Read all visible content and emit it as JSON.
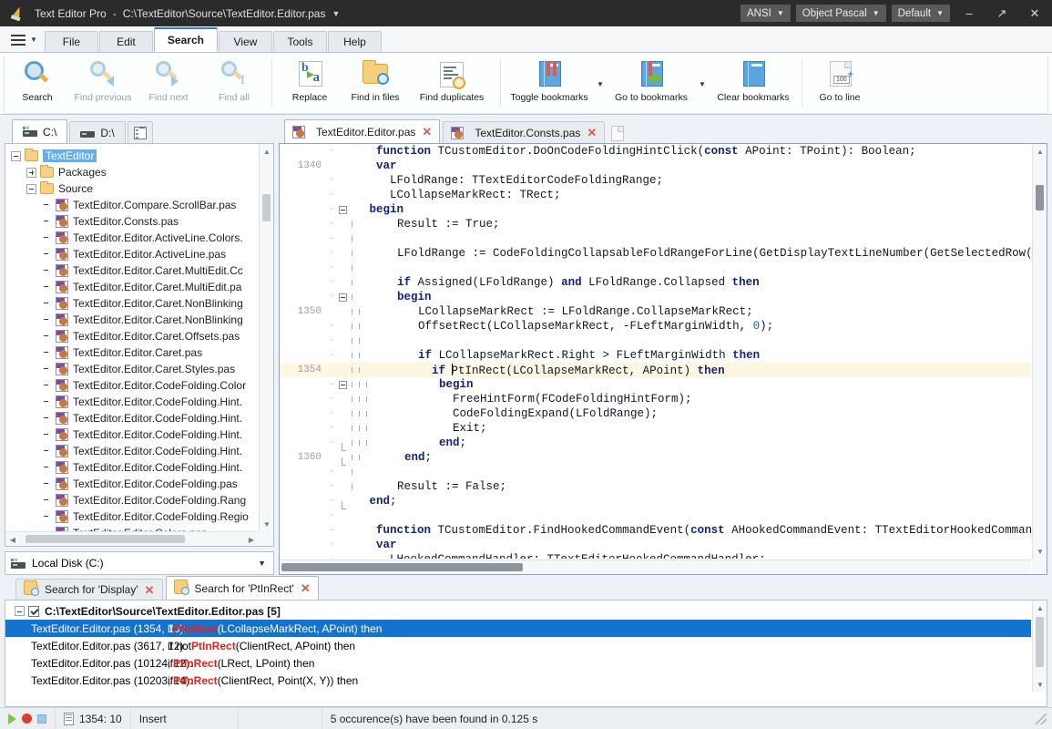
{
  "titlebar": {
    "app_name": "Text Editor Pro",
    "separator": "-",
    "file_path": "C:\\TextEditor\\Source\\TextEditor.Editor.pas",
    "dropdown_caret": "▼",
    "encoding": "ANSI",
    "language": "Object Pascal",
    "theme": "Default",
    "minimize": "–",
    "restore": "↗",
    "close": "✕"
  },
  "menubar": {
    "hamburger_caret": "▼",
    "tabs": [
      {
        "label": "File",
        "active": false
      },
      {
        "label": "Edit",
        "active": false
      },
      {
        "label": "Search",
        "active": true
      },
      {
        "label": "View",
        "active": false
      },
      {
        "label": "Tools",
        "active": false
      },
      {
        "label": "Help",
        "active": false
      }
    ]
  },
  "ribbon": {
    "buttons": [
      {
        "label": "Search",
        "icon": "search-magnifier-icon",
        "disabled": false
      },
      {
        "label": "Find previous",
        "icon": "find-previous-icon",
        "disabled": true
      },
      {
        "label": "Find next",
        "icon": "find-next-icon",
        "disabled": true
      },
      {
        "label": "Find all",
        "icon": "find-all-icon",
        "disabled": true
      },
      {
        "label": "Replace",
        "icon": "replace-icon",
        "disabled": false
      },
      {
        "label": "Find in files",
        "icon": "find-in-files-icon",
        "disabled": false
      },
      {
        "label": "Find duplicates",
        "icon": "find-duplicates-icon",
        "disabled": false
      },
      {
        "label": "Toggle bookmarks",
        "icon": "toggle-bookmarks-icon",
        "disabled": false
      },
      {
        "label": "Go to bookmarks",
        "icon": "go-to-bookmarks-icon",
        "disabled": false
      },
      {
        "label": "Clear bookmarks",
        "icon": "clear-bookmarks-icon",
        "disabled": false
      },
      {
        "label": "Go to line",
        "icon": "go-to-line-icon",
        "disabled": false
      }
    ],
    "split_caret": "▼"
  },
  "left_panel": {
    "drive_tabs": [
      {
        "label": "C:\\",
        "active": true
      },
      {
        "label": "D:\\",
        "active": false
      }
    ],
    "list_view_tab": "list-view-icon",
    "tree": [
      {
        "label": "TextEditor",
        "indent": 0,
        "type": "folder",
        "expander": "minus",
        "selected": true
      },
      {
        "label": "Packages",
        "indent": 1,
        "type": "folder",
        "expander": "plus",
        "selected": false
      },
      {
        "label": "Source",
        "indent": 1,
        "type": "folder",
        "expander": "minus",
        "selected": false
      },
      {
        "label": "TextEditor.Compare.ScrollBar.pas",
        "indent": 2,
        "type": "pas",
        "expander": "none",
        "selected": false
      },
      {
        "label": "TextEditor.Consts.pas",
        "indent": 2,
        "type": "pas",
        "expander": "none",
        "selected": false
      },
      {
        "label": "TextEditor.Editor.ActiveLine.Colors.",
        "indent": 2,
        "type": "pas",
        "expander": "none",
        "selected": false
      },
      {
        "label": "TextEditor.Editor.ActiveLine.pas",
        "indent": 2,
        "type": "pas",
        "expander": "none",
        "selected": false
      },
      {
        "label": "TextEditor.Editor.Caret.MultiEdit.Cc",
        "indent": 2,
        "type": "pas",
        "expander": "none",
        "selected": false
      },
      {
        "label": "TextEditor.Editor.Caret.MultiEdit.pa",
        "indent": 2,
        "type": "pas",
        "expander": "none",
        "selected": false
      },
      {
        "label": "TextEditor.Editor.Caret.NonBlinking",
        "indent": 2,
        "type": "pas",
        "expander": "none",
        "selected": false
      },
      {
        "label": "TextEditor.Editor.Caret.NonBlinking",
        "indent": 2,
        "type": "pas",
        "expander": "none",
        "selected": false
      },
      {
        "label": "TextEditor.Editor.Caret.Offsets.pas",
        "indent": 2,
        "type": "pas",
        "expander": "none",
        "selected": false
      },
      {
        "label": "TextEditor.Editor.Caret.pas",
        "indent": 2,
        "type": "pas",
        "expander": "none",
        "selected": false
      },
      {
        "label": "TextEditor.Editor.Caret.Styles.pas",
        "indent": 2,
        "type": "pas",
        "expander": "none",
        "selected": false
      },
      {
        "label": "TextEditor.Editor.CodeFolding.Color",
        "indent": 2,
        "type": "pas",
        "expander": "none",
        "selected": false
      },
      {
        "label": "TextEditor.Editor.CodeFolding.Hint.",
        "indent": 2,
        "type": "pas",
        "expander": "none",
        "selected": false
      },
      {
        "label": "TextEditor.Editor.CodeFolding.Hint.",
        "indent": 2,
        "type": "pas",
        "expander": "none",
        "selected": false
      },
      {
        "label": "TextEditor.Editor.CodeFolding.Hint.",
        "indent": 2,
        "type": "pas",
        "expander": "none",
        "selected": false
      },
      {
        "label": "TextEditor.Editor.CodeFolding.Hint.",
        "indent": 2,
        "type": "pas",
        "expander": "none",
        "selected": false
      },
      {
        "label": "TextEditor.Editor.CodeFolding.Hint.",
        "indent": 2,
        "type": "pas",
        "expander": "none",
        "selected": false
      },
      {
        "label": "TextEditor.Editor.CodeFolding.pas",
        "indent": 2,
        "type": "pas",
        "expander": "none",
        "selected": false
      },
      {
        "label": "TextEditor.Editor.CodeFolding.Rang",
        "indent": 2,
        "type": "pas",
        "expander": "none",
        "selected": false
      },
      {
        "label": "TextEditor.Editor.CodeFolding.Regio",
        "indent": 2,
        "type": "pas",
        "expander": "none",
        "selected": false
      },
      {
        "label": "TextEditor.Editor.Colors.pas",
        "indent": 2,
        "type": "pas",
        "expander": "none",
        "selected": false
      }
    ],
    "drive_combo": {
      "label": "Local Disk (C:)",
      "caret": "▼"
    }
  },
  "editor": {
    "tabs": [
      {
        "label": "TextEditor.Editor.pas",
        "active": true,
        "close": "✕"
      },
      {
        "label": "TextEditor.Consts.pas",
        "active": false,
        "close": "✕"
      }
    ],
    "lines": [
      {
        "num": "",
        "dot": "·",
        "fold": "none",
        "depth": 0,
        "highlight": false,
        "tokens": [
          {
            "t": "    ",
            "k": "p"
          },
          {
            "t": "function",
            "k": "kw"
          },
          {
            "t": " TCustomEditor.DoOnCodeFoldingHintClick(",
            "k": "p"
          },
          {
            "t": "const",
            "k": "kw"
          },
          {
            "t": " APoint: TPoint): Boolean;",
            "k": "p"
          }
        ]
      },
      {
        "num": "1340",
        "dot": "",
        "fold": "none",
        "depth": 0,
        "highlight": false,
        "tokens": [
          {
            "t": "    ",
            "k": "p"
          },
          {
            "t": "var",
            "k": "kw"
          }
        ]
      },
      {
        "num": "",
        "dot": "·",
        "fold": "none",
        "depth": 0,
        "highlight": false,
        "tokens": [
          {
            "t": "      LFoldRange: TTextEditorCodeFoldingRange;",
            "k": "p"
          }
        ]
      },
      {
        "num": "",
        "dot": "·",
        "fold": "none",
        "depth": 0,
        "highlight": false,
        "tokens": [
          {
            "t": "      LCollapseMarkRect: TRect;",
            "k": "p"
          }
        ]
      },
      {
        "num": "",
        "dot": "·",
        "fold": "box",
        "depth": 0,
        "highlight": false,
        "tokens": [
          {
            "t": "   ",
            "k": "p"
          },
          {
            "t": "begin",
            "k": "kw"
          }
        ]
      },
      {
        "num": "",
        "dot": "·",
        "fold": "line",
        "depth": 1,
        "highlight": false,
        "tokens": [
          {
            "t": "      Result := True;",
            "k": "p"
          }
        ]
      },
      {
        "num": "",
        "dot": "–",
        "fold": "line",
        "depth": 1,
        "highlight": false,
        "tokens": [
          {
            "t": "",
            "k": "p"
          }
        ]
      },
      {
        "num": "",
        "dot": "·",
        "fold": "line",
        "depth": 1,
        "highlight": false,
        "tokens": [
          {
            "t": "      LFoldRange := CodeFoldingCollapsableFoldRangeForLine(GetDisplayTextLineNumber(GetSelectedRow(APoint.Y)",
            "k": "p"
          }
        ]
      },
      {
        "num": "",
        "dot": "·",
        "fold": "line",
        "depth": 1,
        "highlight": false,
        "tokens": [
          {
            "t": "",
            "k": "p"
          }
        ]
      },
      {
        "num": "",
        "dot": "·",
        "fold": "line",
        "depth": 1,
        "highlight": false,
        "tokens": [
          {
            "t": "      ",
            "k": "p"
          },
          {
            "t": "if",
            "k": "kw"
          },
          {
            "t": " Assigned(LFoldRange) ",
            "k": "p"
          },
          {
            "t": "and",
            "k": "kw"
          },
          {
            "t": " LFoldRange.Collapsed ",
            "k": "p"
          },
          {
            "t": "then",
            "k": "kw"
          }
        ]
      },
      {
        "num": "",
        "dot": "·",
        "fold": "box",
        "depth": 1,
        "highlight": false,
        "tokens": [
          {
            "t": "      ",
            "k": "p"
          },
          {
            "t": "begin",
            "k": "kw"
          }
        ]
      },
      {
        "num": "1350",
        "dot": "",
        "fold": "line2",
        "depth": 2,
        "highlight": false,
        "tokens": [
          {
            "t": "        LCollapseMarkRect := LFoldRange.CollapseMarkRect;",
            "k": "p"
          }
        ]
      },
      {
        "num": "",
        "dot": "·",
        "fold": "line2",
        "depth": 2,
        "highlight": false,
        "tokens": [
          {
            "t": "        OffsetRect(LCollapseMarkRect, -FLeftMarginWidth, ",
            "k": "p"
          },
          {
            "t": "0",
            "k": "num"
          },
          {
            "t": ");",
            "k": "p"
          }
        ]
      },
      {
        "num": "",
        "dot": "·",
        "fold": "line2",
        "depth": 2,
        "highlight": false,
        "tokens": [
          {
            "t": "",
            "k": "p"
          }
        ]
      },
      {
        "num": "",
        "dot": "·",
        "fold": "line2",
        "depth": 2,
        "highlight": false,
        "tokens": [
          {
            "t": "        ",
            "k": "p"
          },
          {
            "t": "if",
            "k": "kw"
          },
          {
            "t": " LCollapseMarkRect.Right > FLeftMarginWidth ",
            "k": "p"
          },
          {
            "t": "then",
            "k": "kw"
          }
        ]
      },
      {
        "num": "1354",
        "dot": "",
        "fold": "line2",
        "depth": 2,
        "highlight": true,
        "tokens": [
          {
            "t": "          ",
            "k": "p"
          },
          {
            "t": "if",
            "k": "kw"
          },
          {
            "t": " ",
            "k": "p"
          },
          {
            "t": "|",
            "k": "caret"
          },
          {
            "t": "PtInRect(LCollapseMarkRect, APoint) ",
            "k": "p"
          },
          {
            "t": "then",
            "k": "kw"
          }
        ]
      },
      {
        "num": "",
        "dot": "–",
        "fold": "box2",
        "depth": 3,
        "highlight": false,
        "tokens": [
          {
            "t": "          ",
            "k": "p"
          },
          {
            "t": "begin",
            "k": "kw"
          }
        ]
      },
      {
        "num": "",
        "dot": "·",
        "fold": "line3",
        "depth": 3,
        "highlight": false,
        "tokens": [
          {
            "t": "            FreeHintForm(FCodeFoldingHintForm);",
            "k": "p"
          }
        ]
      },
      {
        "num": "",
        "dot": "·",
        "fold": "line3",
        "depth": 3,
        "highlight": false,
        "tokens": [
          {
            "t": "            CodeFoldingExpand(LFoldRange);",
            "k": "p"
          }
        ]
      },
      {
        "num": "",
        "dot": "·",
        "fold": "line3",
        "depth": 3,
        "highlight": false,
        "tokens": [
          {
            "t": "            Exit;",
            "k": "p"
          }
        ]
      },
      {
        "num": "",
        "dot": "·",
        "fold": "end3",
        "depth": 3,
        "highlight": false,
        "tokens": [
          {
            "t": "          ",
            "k": "p"
          },
          {
            "t": "end",
            "k": "kw"
          },
          {
            "t": ";",
            "k": "p"
          }
        ]
      },
      {
        "num": "1360",
        "dot": "",
        "fold": "end2",
        "depth": 2,
        "highlight": false,
        "tokens": [
          {
            "t": "      ",
            "k": "p"
          },
          {
            "t": "end",
            "k": "kw"
          },
          {
            "t": ";",
            "k": "p"
          }
        ]
      },
      {
        "num": "",
        "dot": "·",
        "fold": "line",
        "depth": 1,
        "highlight": false,
        "tokens": [
          {
            "t": "",
            "k": "p"
          }
        ]
      },
      {
        "num": "",
        "dot": "·",
        "fold": "line",
        "depth": 1,
        "highlight": false,
        "tokens": [
          {
            "t": "      Result := False;",
            "k": "p"
          }
        ]
      },
      {
        "num": "",
        "dot": "·",
        "fold": "end1",
        "depth": 0,
        "highlight": false,
        "tokens": [
          {
            "t": "   ",
            "k": "p"
          },
          {
            "t": "end",
            "k": "kw"
          },
          {
            "t": ";",
            "k": "p"
          }
        ]
      },
      {
        "num": "",
        "dot": "·",
        "fold": "none",
        "depth": 0,
        "highlight": false,
        "tokens": [
          {
            "t": "",
            "k": "p"
          }
        ]
      },
      {
        "num": "",
        "dot": "–",
        "fold": "none",
        "depth": 0,
        "highlight": false,
        "tokens": [
          {
            "t": "    ",
            "k": "p"
          },
          {
            "t": "function",
            "k": "kw"
          },
          {
            "t": " TCustomEditor.FindHookedCommandEvent(",
            "k": "p"
          },
          {
            "t": "const",
            "k": "kw"
          },
          {
            "t": " AHookedCommandEvent: TTextEditorHookedCommandEvent):",
            "k": "p"
          }
        ]
      },
      {
        "num": "",
        "dot": "·",
        "fold": "none",
        "depth": 0,
        "highlight": false,
        "tokens": [
          {
            "t": "    ",
            "k": "p"
          },
          {
            "t": "var",
            "k": "kw"
          }
        ]
      },
      {
        "num": "",
        "dot": "·",
        "fold": "none",
        "depth": 0,
        "highlight": false,
        "tokens": [
          {
            "t": "      LHookedCommandHandler: TTextEditorHookedCommandHandler;",
            "k": "p"
          }
        ]
      }
    ]
  },
  "results": {
    "tabs": [
      {
        "label": "Search for 'Display'",
        "active": false,
        "close": "✕"
      },
      {
        "label": "Search for 'PtInRect'",
        "active": true,
        "close": "✕"
      }
    ],
    "header": {
      "label": "C:\\TextEditor\\Source\\TextEditor.Editor.pas [5]",
      "expander": "minus",
      "checked": true
    },
    "rows": [
      {
        "file": "TextEditor.Editor.pas (1354, 10):",
        "pre": "    if ",
        "hit": "PtInRect",
        "post": "(LCollapseMarkRect, APoint) then",
        "selected": true
      },
      {
        "file": "TextEditor.Editor.pas (3617, 12):",
        "pre": "  if not ",
        "hit": "PtInRect",
        "post": "(ClientRect, APoint) then",
        "selected": false
      },
      {
        "file": "TextEditor.Editor.pas (10124, 12):",
        "pre": "    if ",
        "hit": "PtInRect",
        "post": "(LRect, LPoint) then",
        "selected": false
      },
      {
        "file": "TextEditor.Editor.pas (10203, 14):",
        "pre": "      if ",
        "hit": "PtInRect",
        "post": "(ClientRect, Point(X, Y)) then",
        "selected": false
      }
    ]
  },
  "statusbar": {
    "run_icon": "run-icon",
    "stop_icon": "stop-icon",
    "halt_icon": "halt-icon",
    "position": "1354: 10",
    "insert_mode": "Insert",
    "blank": "",
    "message": "5 occurence(s) have been found in 0.125 s"
  }
}
